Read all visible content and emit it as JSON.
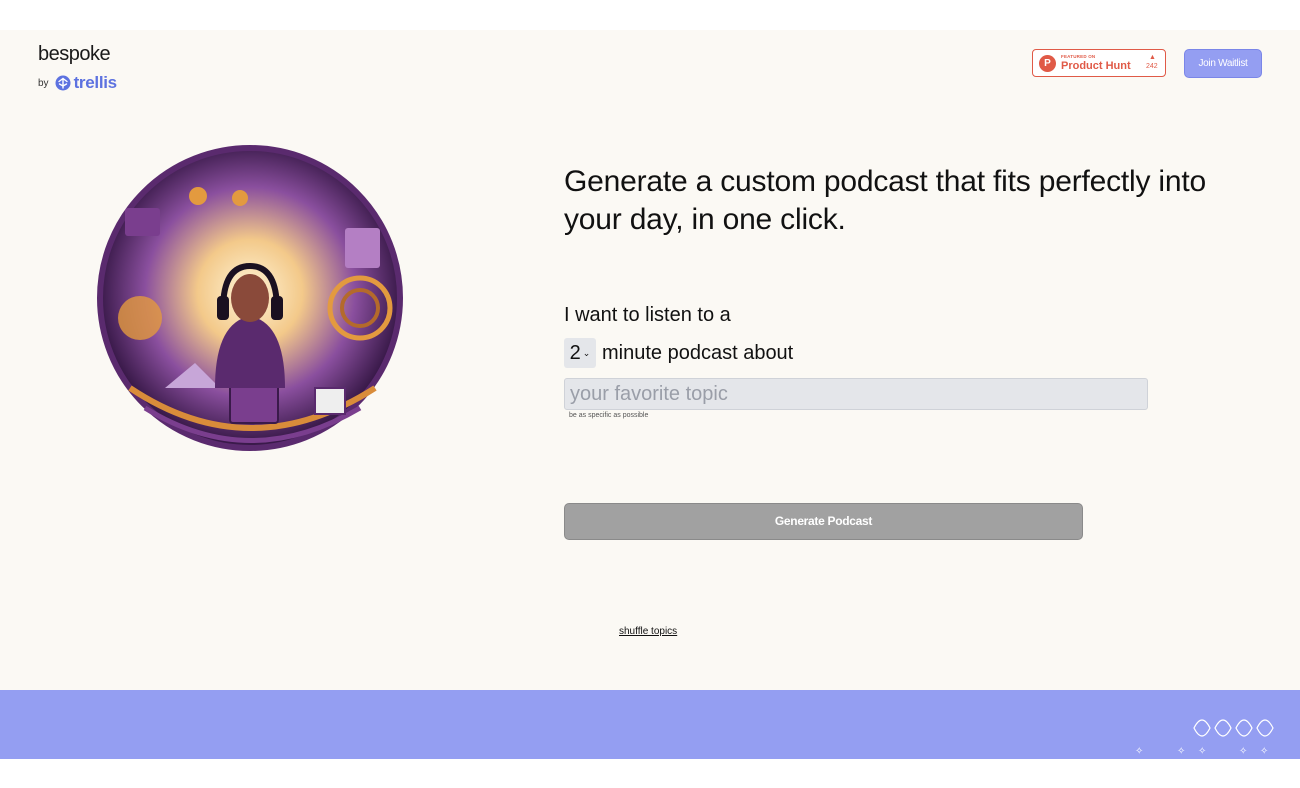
{
  "header": {
    "logo_name": "bespoke",
    "logo_by": "by",
    "logo_brand": "trellis",
    "producthunt": {
      "featured": "FEATURED ON",
      "name": "Product Hunt",
      "count": "242",
      "circle_letter": "P"
    },
    "join_label": "Join Waitlist"
  },
  "main": {
    "headline": "Generate a custom podcast that fits perfectly into your day, in one click.",
    "line1": "I want to listen to a",
    "duration": {
      "selected": "2"
    },
    "line2": "minute podcast about",
    "topic": {
      "placeholder": "your favorite topic",
      "value": ""
    },
    "hint": "be as specific as possible",
    "generate_label": "Generate Podcast",
    "shuffle_label": "shuffle topics"
  },
  "colors": {
    "accent": "#949ef2",
    "brand": "#5d72e0",
    "producthunt": "#e05a47",
    "background": "#fbf9f4",
    "button_disabled": "#a1a1a1"
  },
  "icons": {
    "trellis": "trellis-logo-icon",
    "chevron": "chevron-down-icon",
    "ph_upvote": "triangle-up-icon"
  }
}
